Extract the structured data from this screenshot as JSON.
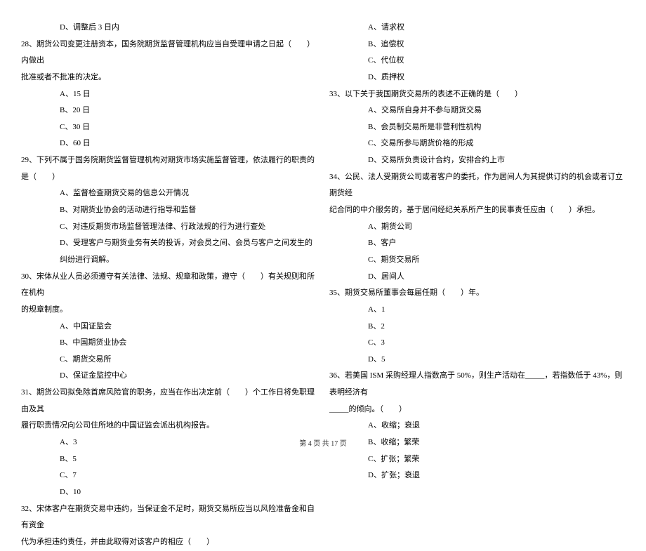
{
  "left": {
    "lines": [
      {
        "cls": "option",
        "bind": "l0",
        "text": "D、调整后 3 日内"
      },
      {
        "cls": "question",
        "bind": "l1",
        "text": "28、期货公司变更注册资本，国务院期货监督管理机构应当自受理申请之日起（　　）内做出"
      },
      {
        "cls": "continuation",
        "bind": "l2",
        "text": "批准或者不批准的决定。"
      },
      {
        "cls": "option",
        "bind": "l3",
        "text": "A、15 日"
      },
      {
        "cls": "option",
        "bind": "l4",
        "text": "B、20 日"
      },
      {
        "cls": "option",
        "bind": "l5",
        "text": "C、30 日"
      },
      {
        "cls": "option",
        "bind": "l6",
        "text": "D、60 日"
      },
      {
        "cls": "question",
        "bind": "l7",
        "text": "29、下列不属于国务院期货监督管理机构对期货市场实施监督管理，依法履行的职责的是（　　）"
      },
      {
        "cls": "option",
        "bind": "l8",
        "text": "A、监督检查期货交易的信息公开情况"
      },
      {
        "cls": "option",
        "bind": "l9",
        "text": "B、对期货业协会的活动进行指导和监督"
      },
      {
        "cls": "option",
        "bind": "l10",
        "text": "C、对违反期货市场监督管理法律、行政法规的行为进行查处"
      },
      {
        "cls": "option",
        "bind": "l11",
        "text": "D、受理客户与期货业务有关的投诉，对会员之间、会员与客户之间发生的纠纷进行调解。"
      },
      {
        "cls": "question",
        "bind": "l12",
        "text": "30、宋体从业人员必须遵守有关法律、法规、规章和政策，遵守（　　）有关规则和所在机构"
      },
      {
        "cls": "continuation",
        "bind": "l13",
        "text": "的规章制度。"
      },
      {
        "cls": "option",
        "bind": "l14",
        "text": "A、中国证监会"
      },
      {
        "cls": "option",
        "bind": "l15",
        "text": "B、中国期货业协会"
      },
      {
        "cls": "option",
        "bind": "l16",
        "text": "C、期货交易所"
      },
      {
        "cls": "option",
        "bind": "l17",
        "text": "D、保证金监控中心"
      },
      {
        "cls": "question",
        "bind": "l18",
        "text": "31、期货公司拟免除首席风险官的职务，应当在作出决定前（　　）个工作日将免职理由及其"
      },
      {
        "cls": "continuation",
        "bind": "l19",
        "text": "履行职责情况向公司住所地的中国证监会派出机构报告。"
      },
      {
        "cls": "option",
        "bind": "l20",
        "text": "A、3"
      },
      {
        "cls": "option",
        "bind": "l21",
        "text": "B、5"
      },
      {
        "cls": "option",
        "bind": "l22",
        "text": "C、7"
      },
      {
        "cls": "option",
        "bind": "l23",
        "text": "D、10"
      },
      {
        "cls": "question",
        "bind": "l24",
        "text": "32、宋体客户在期货交易中违约，当保证金不足时，期货交易所应当以风险准备金和自有资金"
      },
      {
        "cls": "continuation",
        "bind": "l25",
        "text": "代为承担违约责任，并由此取得对该客户的相应（　　）"
      }
    ]
  },
  "right": {
    "lines": [
      {
        "cls": "option",
        "bind": "r0",
        "text": "A、请求权"
      },
      {
        "cls": "option",
        "bind": "r1",
        "text": "B、追偿权"
      },
      {
        "cls": "option",
        "bind": "r2",
        "text": "C、代位权"
      },
      {
        "cls": "option",
        "bind": "r3",
        "text": "D、质押权"
      },
      {
        "cls": "question",
        "bind": "r4",
        "text": "33、以下关于我国期货交易所的表述不正确的是（　　）"
      },
      {
        "cls": "option",
        "bind": "r5",
        "text": "A、交易所自身并不参与期货交易"
      },
      {
        "cls": "option",
        "bind": "r6",
        "text": "B、会员制交易所是非营利性机构"
      },
      {
        "cls": "option",
        "bind": "r7",
        "text": "C、交易所参与期货价格的形成"
      },
      {
        "cls": "option",
        "bind": "r8",
        "text": "D、交易所负责设计合约，安排合约上市"
      },
      {
        "cls": "question",
        "bind": "r9",
        "text": "34、公民、法人受期货公司或者客户的委托，作为居间人为其提供订约的机会或者订立期货经"
      },
      {
        "cls": "continuation",
        "bind": "r10",
        "text": "纪合同的中介服务的，基于居间经纪关系所产生的民事责任应由（　　）承担。"
      },
      {
        "cls": "option",
        "bind": "r11",
        "text": "A、期货公司"
      },
      {
        "cls": "option",
        "bind": "r12",
        "text": "B、客户"
      },
      {
        "cls": "option",
        "bind": "r13",
        "text": "C、期货交易所"
      },
      {
        "cls": "option",
        "bind": "r14",
        "text": "D、居间人"
      },
      {
        "cls": "question",
        "bind": "r15",
        "text": "35、期货交易所董事会每届任期（　　）年。"
      },
      {
        "cls": "option",
        "bind": "r16",
        "text": "A、1"
      },
      {
        "cls": "option",
        "bind": "r17",
        "text": "B、2"
      },
      {
        "cls": "option",
        "bind": "r18",
        "text": "C、3"
      },
      {
        "cls": "option",
        "bind": "r19",
        "text": "D、5"
      },
      {
        "cls": "question",
        "bind": "r20",
        "text": "36、若美国 ISM 采购经理人指数高于 50%，则生产活动在_____，若指数低于 43%，则表明经济有"
      },
      {
        "cls": "continuation",
        "bind": "r21",
        "text": "_____的倾向。（　　）"
      },
      {
        "cls": "option",
        "bind": "r22",
        "text": "A、收缩；衰退"
      },
      {
        "cls": "option",
        "bind": "r23",
        "text": "B、收缩；繁荣"
      },
      {
        "cls": "option",
        "bind": "r24",
        "text": "C、扩张；繁荣"
      },
      {
        "cls": "option",
        "bind": "r25",
        "text": "D、扩张；衰退"
      }
    ]
  },
  "footer": "第 4 页 共 17 页"
}
